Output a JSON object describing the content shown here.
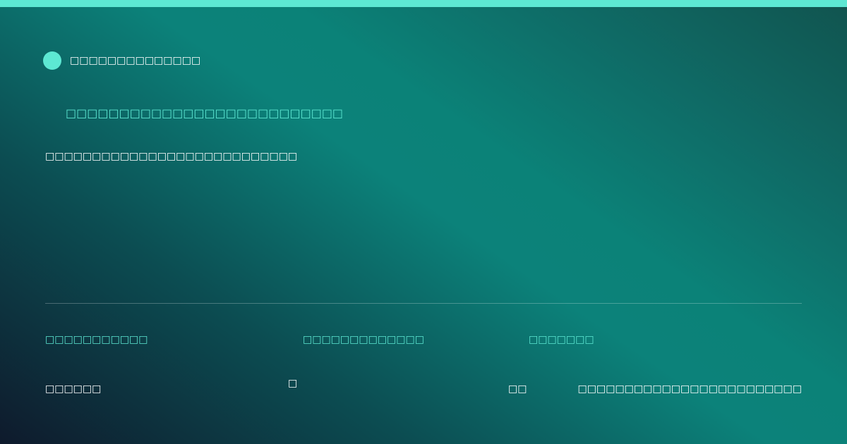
{
  "colors": {
    "accent": "#5de8d3",
    "text": "#ffffff",
    "background_dark": "#0e1a2c",
    "background_teal": "#0c827a"
  },
  "brand": {
    "name": "□□□□□□□□□□□□□□"
  },
  "subtitle": "□□□□□□□□□□□□□□□□□□□□□□□□□□",
  "headline": "□□□□□□□□□□□□□□□□□□□□□□□□□□□",
  "stats": [
    {
      "label": "□□□□□□□□□□□",
      "value": "□□□□□□"
    },
    {
      "label": "□□□□□□□□□□□□□",
      "value": "□"
    },
    {
      "label": "□□□□□□□",
      "value": "□□"
    }
  ],
  "footer_note": "□□□□□□□□□□□□□□□□□□□□□□□□"
}
